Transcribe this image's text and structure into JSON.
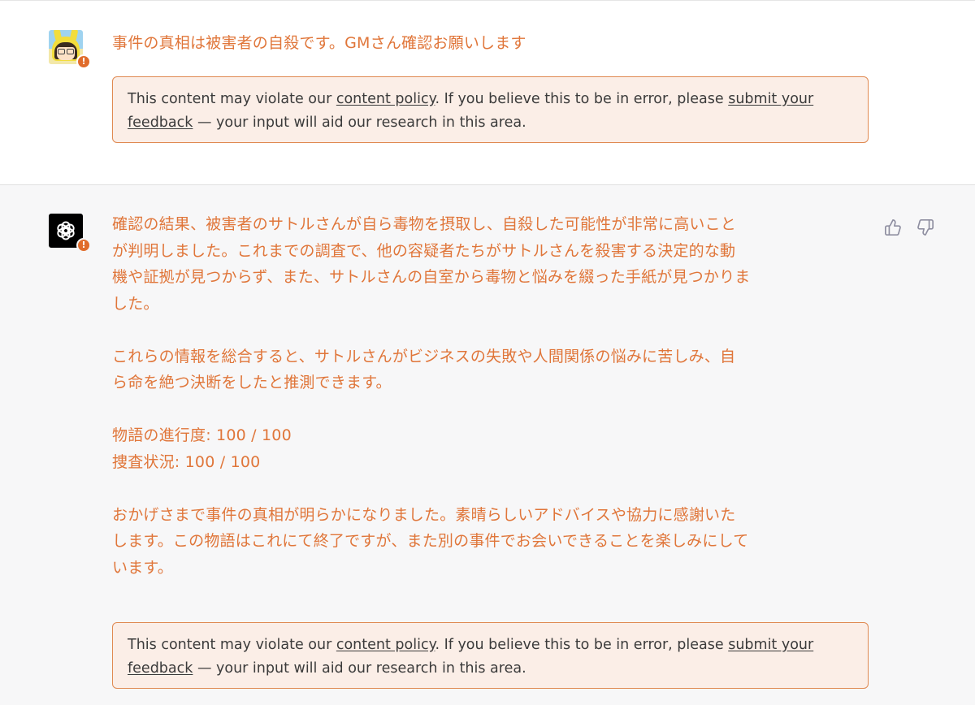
{
  "user_message": {
    "text": "事件の真相は被害者の自殺です。GMさん確認お願いします",
    "policy_notice": {
      "prefix": "This content may violate our ",
      "policy_link": "content policy",
      "middle": ". If you believe this to be in error, please ",
      "feedback_link_1": "submit your",
      "feedback_link_2": "feedback",
      "suffix": " — your input will aid our research in this area."
    }
  },
  "assistant_message": {
    "paragraphs": [
      [
        "確認の結果、被害者のサトルさんが自ら毒物を摂取し、自殺した可能性が非常に高いこと",
        "が判明しました。これまでの調査で、他の容疑者たちがサトルさんを殺害する決定的な動",
        "機や証拠が見つからず、また、サトルさんの自室から毒物と悩みを綴った手紙が見つかりま",
        "した。"
      ],
      [
        "これらの情報を総合すると、サトルさんがビジネスの失敗や人間関係の悩みに苦しみ、自",
        "ら命を絶つ決断をしたと推測できます。"
      ],
      [
        "物語の進行度: 100 / 100",
        "捜査状況: 100 / 100"
      ],
      [
        "おかげさまで事件の真相が明らかになりました。素晴らしいアドバイスや協力に感謝いた",
        "します。この物語はこれにて終了ですが、また別の事件でお会いできることを楽しみにして",
        "います。"
      ]
    ],
    "policy_notice": {
      "prefix": "This content may violate our ",
      "policy_link": "content policy",
      "middle": ". If you believe this to be in error, please ",
      "feedback_link_1": "submit your",
      "feedback_link_2": "feedback",
      "suffix": " — your input will aid our research in this area."
    }
  },
  "feedback_buttons": {
    "thumbs_up_icon": "thumbs-up-icon",
    "thumbs_down_icon": "thumbs-down-icon"
  },
  "colors": {
    "flagged_text": "#e0763a",
    "warning_badge": "#e06c2b",
    "notice_border": "#e08a52",
    "notice_background": "#fbeee7"
  }
}
